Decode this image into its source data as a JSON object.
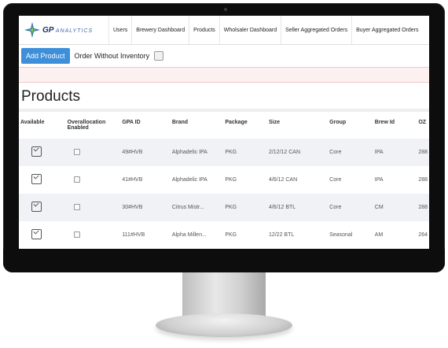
{
  "nav": {
    "logo_main": "GP",
    "logo_sub": "ANALYTICS",
    "items": [
      {
        "label": "Users"
      },
      {
        "label": "Brewery Dashboard"
      },
      {
        "label": "Products"
      },
      {
        "label": "Wholsaler Dashboard"
      },
      {
        "label": "Seller Aggregated Orders"
      },
      {
        "label": "Buyer Aggregated Orders"
      }
    ]
  },
  "toolbar": {
    "add_product_label": "Add Product",
    "order_without_inventory_label": "Order Without Inventory"
  },
  "page": {
    "title": "Products"
  },
  "table": {
    "headers": {
      "available": "Available",
      "overallocation": "Overallocation Enabled",
      "gpa_id": "GPA ID",
      "brand": "Brand",
      "package": "Package",
      "size": "Size",
      "group": "Group",
      "brew_id": "Brew Id",
      "oz": "OZ"
    },
    "rows": [
      {
        "gpa_id": "49#HVB",
        "brand": "Alphadelic IPA",
        "package": "PKG",
        "size": "2/12/12 CAN",
        "group": "Core",
        "brew_id": "IPA",
        "oz": "288"
      },
      {
        "gpa_id": "41#HVB",
        "brand": "Alphadelic IPA",
        "package": "PKG",
        "size": "4/6/12 CAN",
        "group": "Core",
        "brew_id": "IPA",
        "oz": "288"
      },
      {
        "gpa_id": "30#HVB",
        "brand": "Citrus Mistr...",
        "package": "PKG",
        "size": "4/6/12 BTL",
        "group": "Core",
        "brew_id": "CM",
        "oz": "288"
      },
      {
        "gpa_id": "111#HVB",
        "brand": "Alpha Millen...",
        "package": "PKG",
        "size": "12/22 BTL",
        "group": "Seasonal",
        "brew_id": "AM",
        "oz": "264"
      }
    ]
  }
}
